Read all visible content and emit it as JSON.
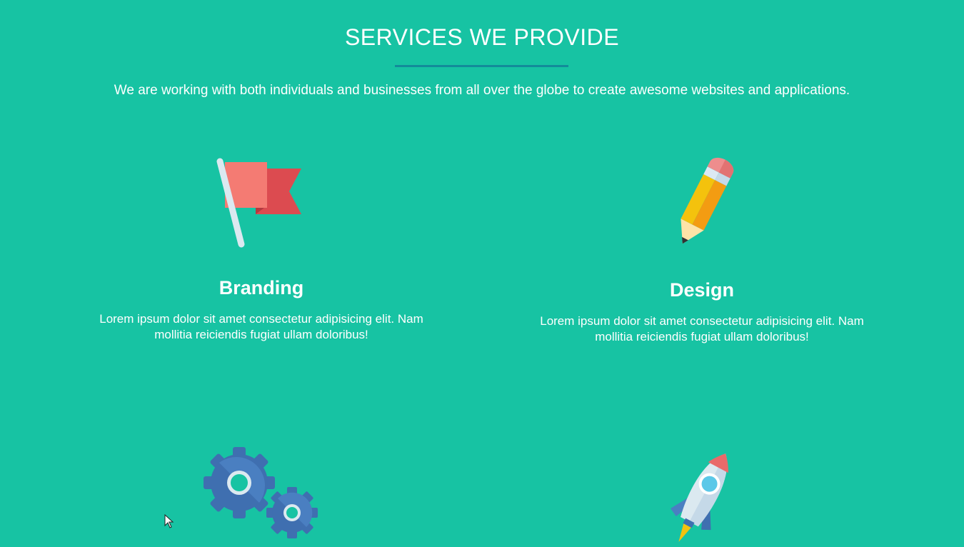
{
  "header": {
    "title": "SERVICES WE PROVIDE",
    "intro": "We are working with both individuals and businesses from all over the globe to create awesome websites and applications."
  },
  "services": [
    {
      "title": "Branding",
      "description": "Lorem ipsum dolor sit amet consectetur adipisicing elit. Nam mollitia reiciendis fugiat ullam doloribus!",
      "icon": "flag-icon"
    },
    {
      "title": "Design",
      "description": "Lorem ipsum dolor sit amet consectetur adipisicing elit. Nam mollitia reiciendis fugiat ullam doloribus!",
      "icon": "pencil-icon"
    },
    {
      "title": "",
      "description": "",
      "icon": "gears-icon"
    },
    {
      "title": "",
      "description": "",
      "icon": "rocket-icon"
    }
  ],
  "colors": {
    "background": "#17c3a3",
    "underline": "#138b9a",
    "text": "#ffffff"
  }
}
